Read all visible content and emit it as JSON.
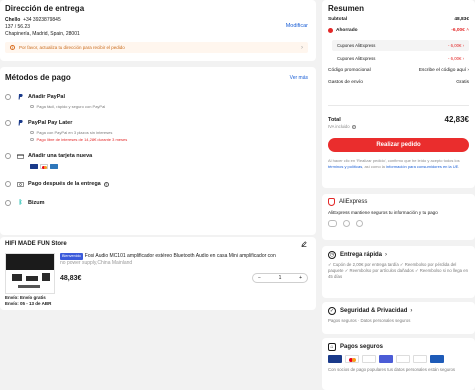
{
  "address": {
    "title": "Dirección de entrega",
    "name": "Chello",
    "phone": "+34 3923879845",
    "line2": "137 / 56.23",
    "line3": "Chapinería, Madrid, Spain, 28001",
    "modify_label": "Modificar",
    "warning": "Por favor, actualiza tu dirección para recibir el pedido"
  },
  "payment": {
    "title": "Métodos de pago",
    "see_more": "Ver más",
    "options": [
      {
        "label": "Añadir PayPal",
        "sub": "Paga fácil, rápido y seguro con PayPal"
      },
      {
        "label": "PayPal Pay Later",
        "sub": "Paga con PayPal en 3 plazos sin intereses",
        "sub2": "Pago libre de intereses de 14,28€ durante 3 meses"
      },
      {
        "label": "Añadir una tarjeta nueva"
      },
      {
        "label": "Pago después de la entrega"
      },
      {
        "label": "Bizum"
      }
    ]
  },
  "store": {
    "name": "HIFI MADE FUN Store",
    "badge": "Bienvenido",
    "product_title": "Fosi Audio MC101 amplificador estéreo Bluetooth Audio en casa Mini amplificador con",
    "product_sub": "no power supply,China Mainland",
    "price": "48,83€",
    "quantity": "1",
    "minus": "−",
    "plus": "+",
    "shipping": "Envío: Envío gratis",
    "delivery": "Envío: 05 - 13 de ABR"
  },
  "summary": {
    "title": "Resumen",
    "subtotal_label": "Subtotal",
    "subtotal_value": "48,83€",
    "saved_label": "Ahorrado",
    "saved_value": "-6,00€",
    "coupon1_label": "Cupones AliExpress",
    "coupon1_value": "- 6,00€",
    "coupon2_label": "Cupones AliExpress",
    "coupon2_value": "- 6,00€",
    "promo_label": "Código promocional",
    "promo_value": "Escribe el código aquí",
    "shipping_label": "Gastos de envío",
    "shipping_value": "Gratis",
    "total_label": "Total",
    "total_value": "42,83€",
    "vat_label": "IVA incluido",
    "pay_button": "Realizar pedido",
    "legal_pre": "Al hacer clic en 'Realizar pedido', confirmo que he leído y acepto todos los ",
    "legal_link1": "términos y políticas",
    "legal_mid": ", así como la ",
    "legal_link2": "información para consumidores en la UE",
    "legal_end": "."
  },
  "brand": {
    "name": "AliExpress",
    "text": "AliExpress mantiene seguros tu información y tu pago"
  },
  "delivery_card": {
    "title": "Entrega rápida",
    "lines": [
      "✓ Cupón de 2,00€ por entrega tardía  ✓ Reembolso por pérdida del paquete  ✓ Reembolso por artículos dañados  ✓ Reembolso si no llega en 45 días"
    ]
  },
  "security_card": {
    "title": "Seguridad & Privacidad",
    "text": "Pagos seguros · Datos personales seguros"
  },
  "paysafe_card": {
    "title": "Pagos seguros",
    "text": "Con socios de pago populares tus datos personales están seguros"
  },
  "colors": {
    "accent": "#ea2d2d",
    "link": "#1a5fd6",
    "warning_bg": "#fff6ee"
  }
}
